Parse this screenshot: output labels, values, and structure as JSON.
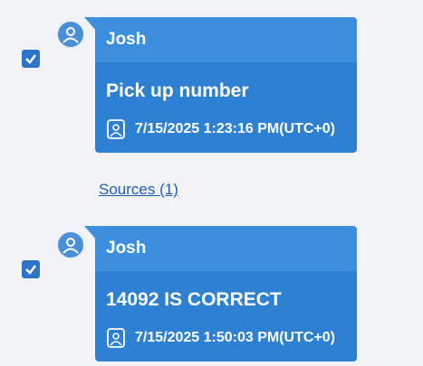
{
  "messages": [
    {
      "checked": true,
      "sender": "Josh",
      "text": "Pick up number",
      "timestamp": "7/15/2025 1:23:16 PM(UTC+0)",
      "avatar_icon": "user-avatar-icon",
      "time_icon": "contact-book-icon"
    },
    {
      "checked": true,
      "sender": "Josh",
      "text": "14092 IS CORRECT",
      "timestamp": "7/15/2025 1:50:03 PM(UTC+0)",
      "avatar_icon": "user-avatar-icon",
      "time_icon": "contact-book-icon"
    }
  ],
  "sources_link": "Sources (1)",
  "colors": {
    "bubble_header": "#3d8fde",
    "bubble_body": "#2e80d3",
    "link": "#1d5fb3",
    "checkbox": "#2d74c9"
  }
}
